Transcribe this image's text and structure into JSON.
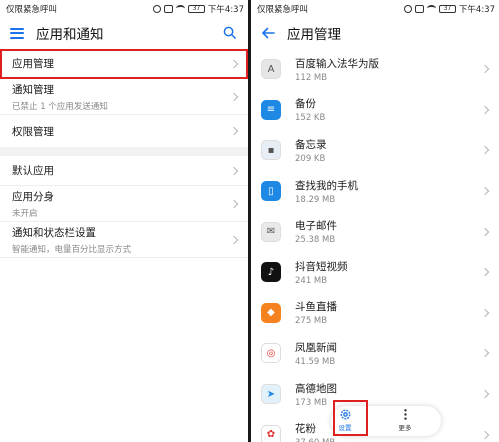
{
  "left": {
    "status": {
      "carrier": "仅限紧急呼叫",
      "battery": "37",
      "time": "下午4:37"
    },
    "header": {
      "title": "应用和通知"
    },
    "items": [
      {
        "title": "应用管理",
        "subtitle": ""
      },
      {
        "title": "通知管理",
        "subtitle": "已禁止 1 个应用发送通知"
      },
      {
        "title": "权限管理",
        "subtitle": ""
      },
      {
        "title": "默认应用",
        "subtitle": ""
      },
      {
        "title": "应用分身",
        "subtitle": "未开启"
      },
      {
        "title": "通知和状态栏设置",
        "subtitle": "智能通知，电量百分比显示方式"
      }
    ]
  },
  "right": {
    "status": {
      "carrier": "仅限紧急呼叫",
      "battery": "37",
      "time": "下午4:37"
    },
    "header": {
      "title": "应用管理"
    },
    "apps": [
      {
        "name": "百度输入法华为版",
        "size": "112 MB",
        "icon": "baidu-input-icon",
        "color": "#e6e6e6",
        "glyph": "A"
      },
      {
        "name": "备份",
        "size": "152 KB",
        "icon": "backup-icon",
        "color": "#1e88e5",
        "glyph": "≡"
      },
      {
        "name": "备忘录",
        "size": "209 KB",
        "icon": "memo-icon",
        "color": "#e8eef5",
        "glyph": "▪"
      },
      {
        "name": "查找我的手机",
        "size": "18.29 MB",
        "icon": "find-phone-icon",
        "color": "#1e88e5",
        "glyph": "▯"
      },
      {
        "name": "电子邮件",
        "size": "25.38 MB",
        "icon": "email-icon",
        "color": "#e9e9e9",
        "glyph": "✉"
      },
      {
        "name": "抖音短视频",
        "size": "241 MB",
        "icon": "douyin-icon",
        "color": "#111111",
        "glyph": "♪"
      },
      {
        "name": "斗鱼直播",
        "size": "275 MB",
        "icon": "douyu-icon",
        "color": "#f5821f",
        "glyph": "◆"
      },
      {
        "name": "凤凰新闻",
        "size": "41.59 MB",
        "icon": "ifeng-news-icon",
        "color": "#ffffff",
        "glyph": "◎"
      },
      {
        "name": "高德地图",
        "size": "173 MB",
        "icon": "amap-icon",
        "color": "#e3f1fb",
        "glyph": "➤"
      },
      {
        "name": "花粉",
        "size": "37.60 MB",
        "icon": "huafen-icon",
        "color": "#ffffff",
        "glyph": "✿"
      }
    ],
    "bottom_bar": {
      "settings_label": "设置",
      "more_label": "更多"
    }
  },
  "colors": {
    "accent": "#1a73e8",
    "highlight": "#e02020"
  }
}
